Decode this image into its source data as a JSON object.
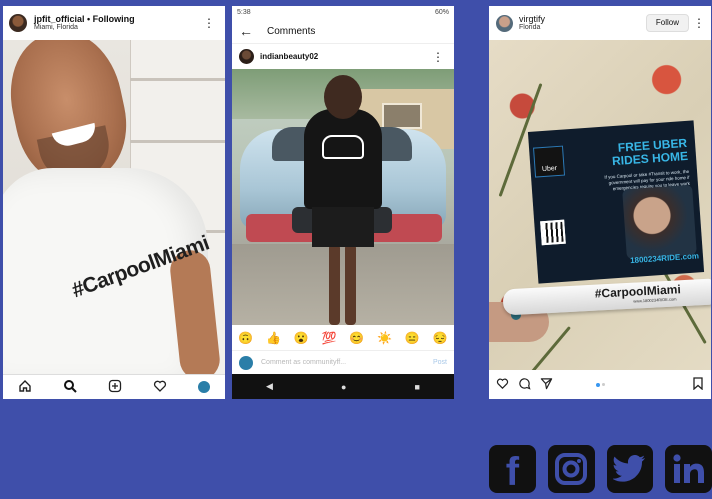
{
  "post1": {
    "username": "jpfit_official • Following",
    "location": "Miami, Florida",
    "shirt_text": "#CarpoolMiami",
    "nav_icons": [
      "home-icon",
      "search-icon",
      "add-icon",
      "heart-icon",
      "profile-icon"
    ]
  },
  "post2": {
    "status_time": "5:38",
    "status_right": "60%",
    "title": "Comments",
    "username": "indianbeauty02",
    "emojis": [
      "🙃",
      "👍",
      "😮",
      "💯",
      "😊",
      "☀️",
      "😑",
      "😔"
    ],
    "comment_placeholder": "Comment as communityff...",
    "post_label": "Post",
    "nav_back": "◀",
    "nav_home": "●",
    "nav_recent": "■"
  },
  "post3": {
    "username": "virgtify",
    "location": "Florida",
    "follow_label": "Follow",
    "flyer_brand": "Uber",
    "flyer_headline": "FREE UBER RIDES HOME",
    "flyer_fine": "If you Carpool or take #Transit to work, the government will pay for your ride home if emergencies require you to leave work early or if you have to work late.",
    "flyer_site": "1800234RIDE.com",
    "pen_text": "#CarpoolMiami",
    "pen_sub": "www.1800234RIDE.com"
  },
  "social": [
    "facebook-icon",
    "instagram-icon",
    "twitter-icon",
    "linkedin-icon"
  ],
  "colors": {
    "background": "#3f4faa",
    "instagram_blue": "#3897f0",
    "social_dark": "#111111"
  }
}
